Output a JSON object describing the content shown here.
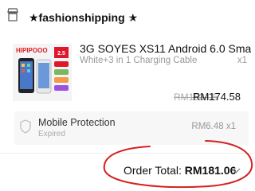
{
  "shop": {
    "name": "★fashionshipping ★",
    "chevron": "›"
  },
  "product": {
    "title": "3G SOYES XS11 Android 6.0  Sma…",
    "variant": "White+3 in 1 Charging Cable",
    "quantity": "x1",
    "original_price": "RM193.05",
    "price": "RM174.58",
    "image": {
      "brand": "HIPIPOOO",
      "badge": "2.5",
      "icon": "phone-product-image"
    }
  },
  "protection": {
    "title": "Mobile Protection",
    "status": "Expired",
    "price": "RM6.48 x1",
    "icon": "shield-icon",
    "chevron": "›"
  },
  "order": {
    "label": "Order Total:",
    "amount": "RM181.06",
    "icon": "chevron-down-icon"
  },
  "colors": {
    "annotation": "#d62020",
    "brand_text": "#e02020",
    "badge": "#e0162b"
  }
}
